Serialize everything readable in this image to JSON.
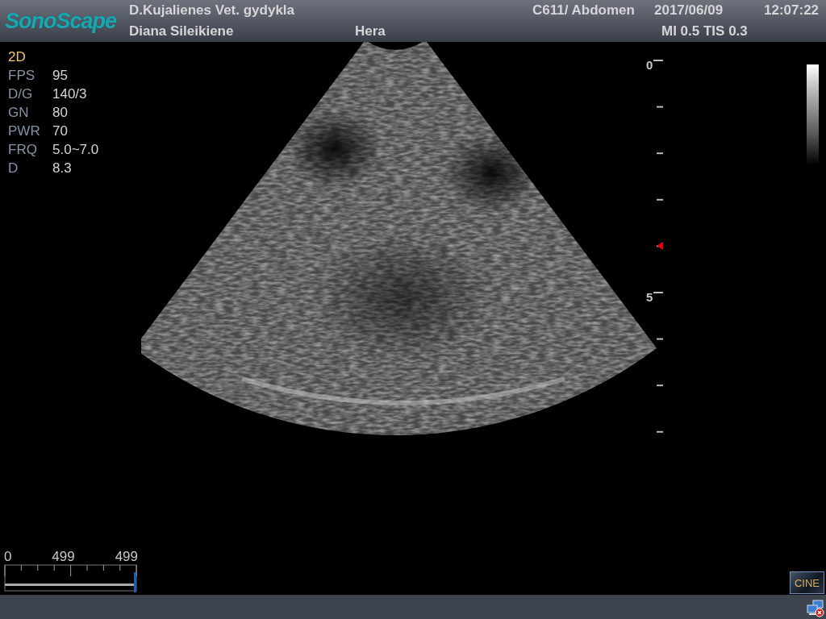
{
  "header": {
    "logo": "SonoScape",
    "clinic": "D.Kujalienes Vet. gydykla",
    "operator": "Diana Sileikiene",
    "patient": "Hera",
    "probe_preset": "C611/ Abdomen",
    "date": "2017/06/09",
    "time": "12:07:22",
    "indices": "MI 0.5 TIS 0.3"
  },
  "mode": "2D",
  "parameters": [
    {
      "label": "FPS",
      "value": "95"
    },
    {
      "label": "D/G",
      "value": "140/3"
    },
    {
      "label": "GN",
      "value": "80"
    },
    {
      "label": "PWR",
      "value": "70"
    },
    {
      "label": "FRQ",
      "value": "5.0~7.0"
    },
    {
      "label": "D",
      "value": "8.3"
    }
  ],
  "depth_scale": {
    "labels": [
      "0",
      "5"
    ]
  },
  "cine": {
    "start": "0",
    "current": "499",
    "total": "499",
    "level": 1
  },
  "cine_button": "CINE"
}
